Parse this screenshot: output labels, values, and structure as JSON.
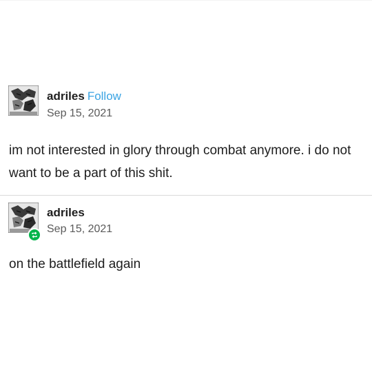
{
  "posts": [
    {
      "username": "adriles",
      "follow_label": "Follow",
      "date": "Sep 15, 2021",
      "text": "im not interested in glory through combat anymore. i do not want to be a part of this shit.",
      "avatar_icon": "comic-avatar-icon"
    },
    {
      "username": "adriles",
      "date": "Sep 15, 2021",
      "text": "on the battlefield again",
      "avatar_icon": "comic-avatar-icon",
      "badge_icon": "reblog-icon"
    }
  ],
  "colors": {
    "follow": "#3aa3e3",
    "reblog_badge": "#00b44a",
    "divider": "#d9d9d9"
  }
}
